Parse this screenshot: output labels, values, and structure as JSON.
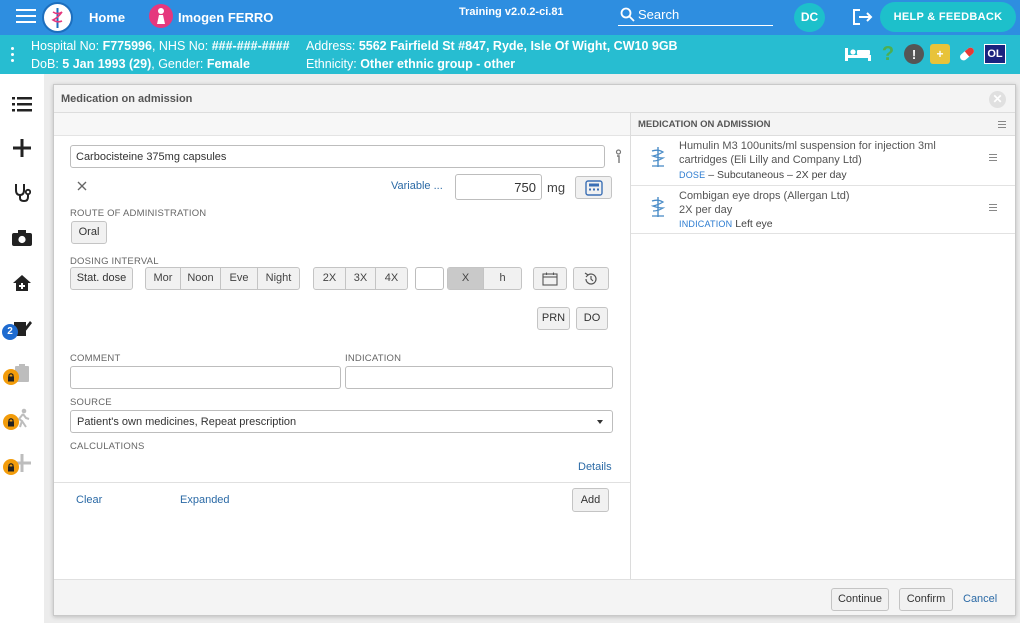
{
  "topbar": {
    "home_label": "Home",
    "patient_name": "Imogen FERRO",
    "version": "Training v2.0.2-ci.81",
    "search_placeholder": "Search",
    "user_initials": "DC",
    "help_label": "HELP & FEEDBACK",
    "accent_color": "#2e8ee0"
  },
  "banner": {
    "hospital_label": "Hospital No:",
    "hospital_no": "F775996",
    "nhs_label": "NHS No:",
    "nhs_no": "###-###-####",
    "address_label": "Address:",
    "address": "5562 Fairfield St #847, Ryde, Isle Of Wight, CW10 9GB",
    "dob_label": "DoB:",
    "dob": "5 Jan 1993 (29)",
    "gender_label": "Gender:",
    "gender": "Female",
    "ethnicity_label": "Ethnicity:",
    "ethnicity": "Other ethnic group - other",
    "ol_label": "OL",
    "banner_color": "#27bdd1"
  },
  "rail": {
    "items": [
      "list-icon",
      "plus-icon",
      "stethoscope-icon",
      "camera-icon",
      "home-plus-icon",
      "edit-icon",
      "clipboard-icon",
      "walking-icon",
      "add-icon"
    ],
    "edit_badge": "2"
  },
  "dialog": {
    "title": "Medication on admission",
    "form": {
      "medication_value": "Carbocisteine 375mg capsules",
      "variable_label": "Variable ...",
      "dose_value": "750",
      "dose_unit": "mg",
      "route_label": "ROUTE OF ADMINISTRATION",
      "route_value": "Oral",
      "dosing_label": "DOSING INTERVAL",
      "stat_dose": "Stat. dose",
      "times": [
        "Mor",
        "Noon",
        "Eve",
        "Night"
      ],
      "freq": [
        "2X",
        "3X",
        "4X"
      ],
      "interval_unit_x": "X",
      "interval_unit_h": "h",
      "prn": "PRN",
      "do": "DO",
      "comment_label": "COMMENT",
      "indication_label": "INDICATION",
      "source_label": "SOURCE",
      "source_value": "Patient's own medicines, Repeat prescription",
      "calculations_label": "CALCULATIONS",
      "details_link": "Details",
      "clear_link": "Clear",
      "expanded_link": "Expanded",
      "add_button": "Add"
    },
    "right": {
      "title": "MEDICATION ON ADMISSION",
      "items": [
        {
          "name_line1": "Humulin M3 100units/ml suspension for injection 3ml",
          "name_line2": "cartridges (Eli Lilly and Company Ltd)",
          "meta_key": "DOSE",
          "meta_value": "– Subcutaneous – 2X per day"
        },
        {
          "name_line1": "Combigan eye drops (Allergan Ltd)",
          "name_line2": "2X per day",
          "meta_key": "INDICATION",
          "meta_value": "Left eye"
        }
      ]
    },
    "footer": {
      "continue": "Continue",
      "confirm": "Confirm",
      "cancel": "Cancel"
    }
  }
}
